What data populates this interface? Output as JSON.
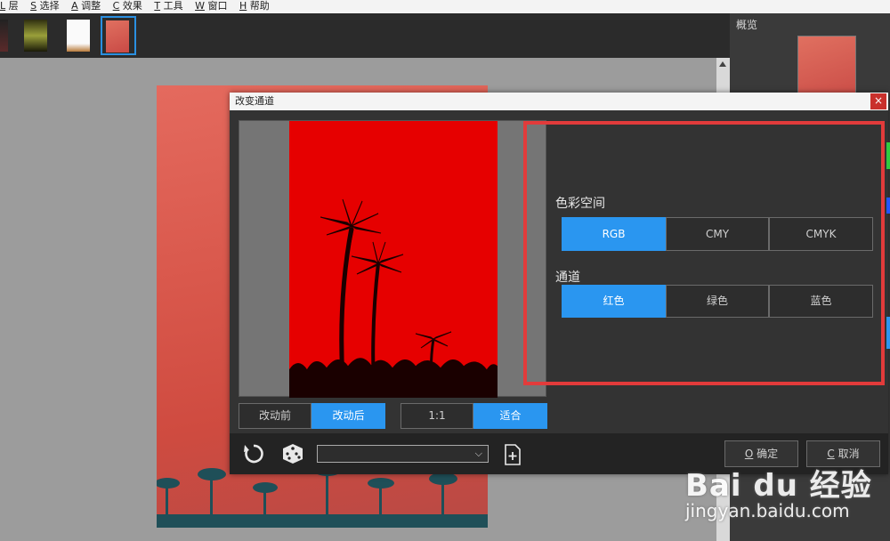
{
  "menu": [
    {
      "key": "L",
      "label": "层"
    },
    {
      "key": "S",
      "label": "选择"
    },
    {
      "key": "A",
      "label": "调整"
    },
    {
      "key": "C",
      "label": "效果"
    },
    {
      "key": "T",
      "label": "工具"
    },
    {
      "key": "W",
      "label": "窗口"
    },
    {
      "key": "H",
      "label": "帮助"
    }
  ],
  "overview": {
    "title": "概览"
  },
  "dialog": {
    "title": "改变通道",
    "close_glyph": "×",
    "color_space_label": "色彩空间",
    "color_space_options": [
      "RGB",
      "CMY",
      "CMYK"
    ],
    "color_space_selected": "RGB",
    "channel_label": "通道",
    "channel_options": [
      "红色",
      "绿色",
      "蓝色"
    ],
    "channel_selected": "红色",
    "before_label": "改动前",
    "after_label": "改动后",
    "zoom_1to1": "1:1",
    "zoom_fit": "适合",
    "ok_key": "O",
    "ok_label": "确定",
    "cancel_key": "C",
    "cancel_label": "取消",
    "preset_value": ""
  },
  "watermark": {
    "brand": "Bai du 经验",
    "url": "jingyan.baidu.com"
  },
  "icons": [
    "reset-icon",
    "dice-icon",
    "chevron-down-icon",
    "save-preset-icon",
    "close-icon"
  ],
  "colors": {
    "accent": "#2a96f0",
    "highlight_box": "#e23b3b",
    "preview_red": "#e60000"
  }
}
